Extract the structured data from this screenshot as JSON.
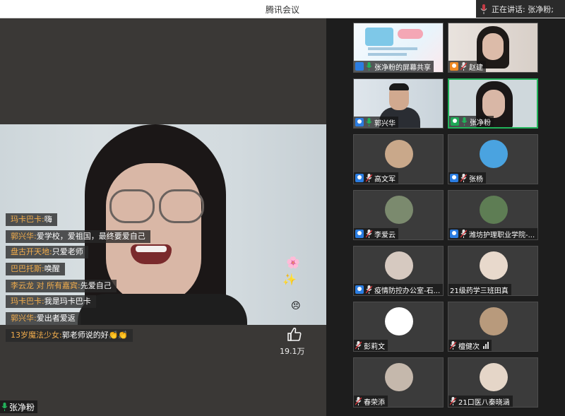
{
  "window": {
    "title": "腾讯会议",
    "speaking_text": "正在讲话: 张净粉;"
  },
  "main_video": {
    "speaker_name": "张净粉",
    "like_count": "19.1万"
  },
  "chat": [
    {
      "user": "玛卡巴卡:",
      "text": "嗨"
    },
    {
      "user": "郭兴华:",
      "text": "爱学校，爱祖国，最终要爱自己"
    },
    {
      "user": "盘古开天地:",
      "text": "只爱老师"
    },
    {
      "user": "巴巴托斯:",
      "text": "唤醒"
    },
    {
      "user": "李云龙 对 所有嘉宾:",
      "text": "先爱自己"
    },
    {
      "user": "玛卡巴卡:",
      "text": "我是玛卡巴卡"
    },
    {
      "user": "郭兴华:",
      "text": "爱出者爱返"
    },
    {
      "user": "13岁魔法少女:",
      "text": "郭老师说的好👏👏"
    }
  ],
  "participants": [
    {
      "name": "张净粉的屏幕共享",
      "badge": "share",
      "mic": "on",
      "kind": "share"
    },
    {
      "name": "赵建",
      "badge": "orange",
      "mic": "muted",
      "kind": "video"
    },
    {
      "name": "郭兴华",
      "badge": "blue",
      "mic": "on",
      "kind": "video-man"
    },
    {
      "name": "张净粉",
      "badge": "green",
      "mic": "on",
      "kind": "video-woman",
      "active": true
    },
    {
      "name": "高文军",
      "badge": "blue",
      "mic": "muted",
      "kind": "avatar",
      "color": "#c9a88a"
    },
    {
      "name": "张杨",
      "badge": "blue",
      "mic": "muted",
      "kind": "avatar",
      "color": "#4aa3e0"
    },
    {
      "name": "李爱云",
      "badge": "blue",
      "mic": "muted",
      "kind": "avatar",
      "color": "#7b8a6e"
    },
    {
      "name": "潍坊护理职业学院-...",
      "badge": "blue",
      "mic": "muted",
      "kind": "avatar",
      "color": "#5e7d54"
    },
    {
      "name": "疫情防控办公室-石...",
      "badge": "blue",
      "mic": "muted",
      "kind": "avatar",
      "color": "#d6c9c0"
    },
    {
      "name": "21级药学三班田真",
      "badge": "none",
      "mic": "none",
      "kind": "avatar",
      "color": "#e8d9cc"
    },
    {
      "name": "彭莉文",
      "badge": "none",
      "mic": "muted",
      "kind": "avatar",
      "color": "#ffffff"
    },
    {
      "name": "檀健次",
      "badge": "none",
      "mic": "muted",
      "kind": "avatar",
      "color": "#b89a7c",
      "bars": true
    },
    {
      "name": "春荣添",
      "badge": "none",
      "mic": "muted",
      "kind": "avatar",
      "color": "#c5b8ac"
    },
    {
      "name": "21口医八秦晓涵",
      "badge": "none",
      "mic": "muted",
      "kind": "avatar",
      "color": "#e5d6c8"
    }
  ],
  "colors": {
    "accent_green": "#22b35a",
    "chat_username": "#f2ad4c",
    "badge_blue": "#2b7de1",
    "badge_orange": "#f08a24"
  }
}
